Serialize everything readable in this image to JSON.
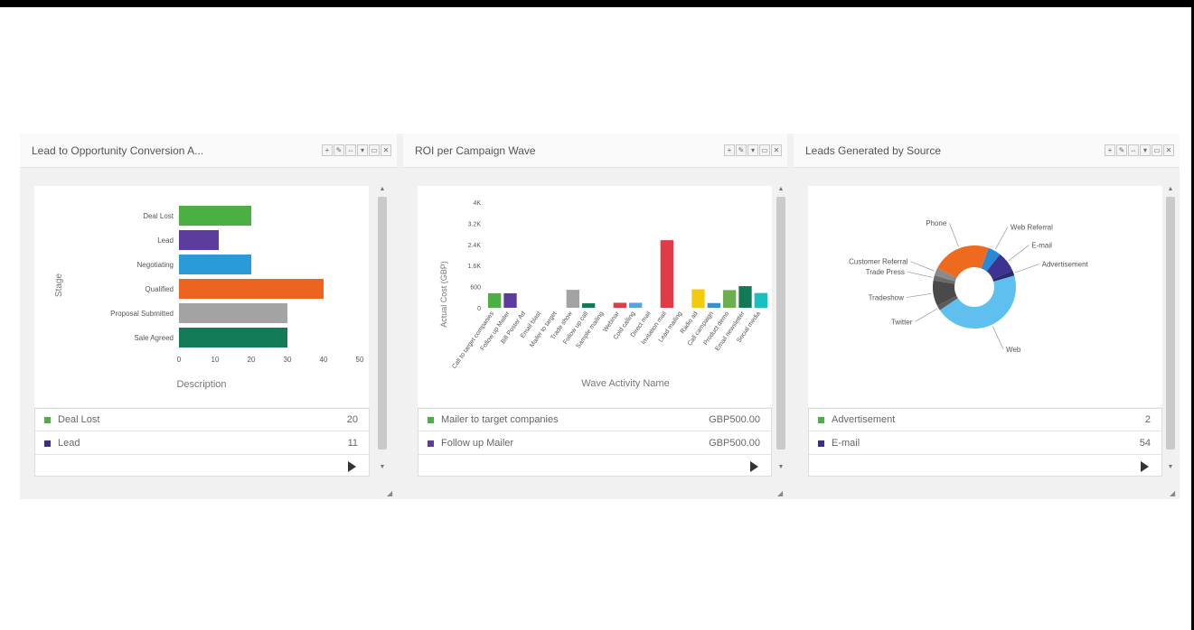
{
  "widgets": [
    {
      "title": "Lead to Opportunity Conversion A...",
      "tool_glyphs": [
        "+",
        "✎",
        "⇔",
        "▾",
        "▭",
        "✕"
      ],
      "chart_data": {
        "type": "bar",
        "orientation": "horizontal",
        "categories": [
          "Deal Lost",
          "Lead",
          "Negotiating",
          "Qualified",
          "Proposal Submitted",
          "Sale Agreed"
        ],
        "values": [
          20,
          11,
          20,
          40,
          30,
          30
        ],
        "colors": [
          "#4caf43",
          "#5c3c9c",
          "#2a9ad8",
          "#ec6420",
          "#a3a3a3",
          "#137a58"
        ],
        "xlabel": "Description",
        "ylabel": "Stage",
        "xticks": [
          "0",
          "10",
          "20",
          "30",
          "40",
          "50"
        ],
        "xlim": [
          0,
          50
        ]
      },
      "legend": [
        {
          "label": "Deal Lost",
          "value": "20",
          "color": "#4caf43"
        },
        {
          "label": "Lead",
          "value": "11",
          "color": "#3a2f8a"
        }
      ]
    },
    {
      "title": "ROI per Campaign Wave",
      "tool_glyphs": [
        "+",
        "✎",
        "▾",
        "▭",
        "✕"
      ],
      "chart_data": {
        "type": "bar",
        "categories": [
          "Call to target companies",
          "Follow up Mailer",
          "Bill Poster Ad",
          "Email blast",
          "Mailer to target",
          "Trade show",
          "Follow up call",
          "Sample mailing",
          "Webinar",
          "Cold calling",
          "Direct mail",
          "Invitation mail",
          "Lead mailing",
          "Radio ad",
          "Call campaign",
          "Product demo",
          "Email newsletter",
          "Social media"
        ],
        "values": [
          550,
          550,
          0,
          0,
          0,
          680,
          170,
          0,
          190,
          190,
          0,
          2560,
          0,
          700,
          180,
          670,
          820,
          560
        ],
        "colors": [
          "#4caf43",
          "#5c3c9c",
          "#a3a3a3",
          "#a3a3a3",
          "#a3a3a3",
          "#a3a3a3",
          "#137a58",
          "#137a58",
          "#e03c48",
          "#5aa3de",
          "#e03c48",
          "#e03c48",
          "#f2cc0c",
          "#f2cc0c",
          "#3a8fd0",
          "#6ab04c",
          "#137a58",
          "#1bbfbf"
        ],
        "xlabel": "Wave Activity Name",
        "ylabel": "Actual Cost (GBP)",
        "yticks": [
          "0",
          "600",
          "1.6K",
          "2.4K",
          "3.2K",
          "4K"
        ],
        "ylim": [
          0,
          4000
        ]
      },
      "legend": [
        {
          "label": "Mailer to target companies",
          "value": "GBP500.00",
          "color": "#4caf43"
        },
        {
          "label": "Follow up Mailer",
          "value": "GBP500.00",
          "color": "#5c3c9c"
        }
      ]
    },
    {
      "title": "Leads Generated by Source",
      "tool_glyphs": [
        "+",
        "✎",
        "⇔",
        "▾",
        "▭",
        "✕"
      ],
      "chart_data": {
        "type": "pie",
        "style": "donut",
        "labels": [
          "Web Referral",
          "E-mail",
          "Advertisement",
          "Web",
          "Twitter",
          "Tradeshow",
          "Trade Press",
          "Customer Referral",
          "Phone"
        ],
        "values": [
          5,
          8,
          2,
          45,
          2,
          10,
          2,
          3,
          23
        ],
        "colors": [
          "#2a88d8",
          "#3c3490",
          "#2a2a6c",
          "#5fc0ef",
          "#5b5b5b",
          "#4a4a4a",
          "#6a6a6a",
          "#8a8a8a",
          "#ee6a1e"
        ]
      },
      "legend": [
        {
          "label": "Advertisement",
          "value": "2",
          "color": "#4caf43"
        },
        {
          "label": "E-mail",
          "value": "54",
          "color": "#3a2f8a"
        }
      ]
    }
  ]
}
